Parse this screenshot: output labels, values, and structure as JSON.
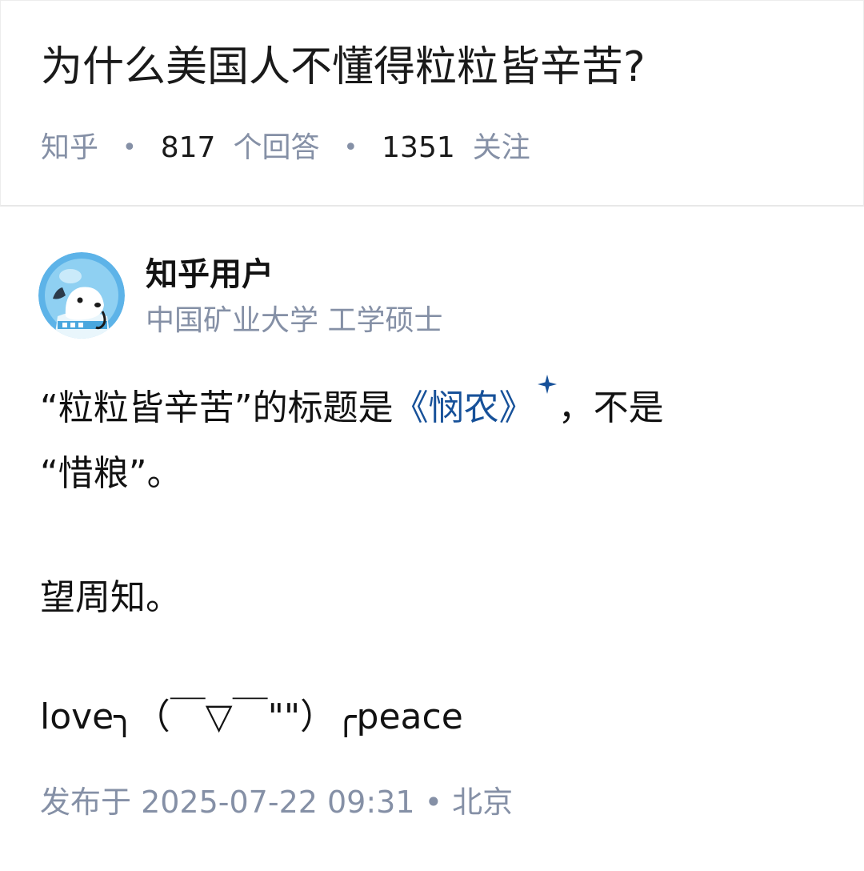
{
  "question": {
    "title": "为什么美国人不懂得粒粒皆辛苦?",
    "source": "知乎",
    "answer_count": "817",
    "answer_count_label": "个回答",
    "follow_count": "1351",
    "follow_label": "关注",
    "separator": "•"
  },
  "answer": {
    "author": {
      "name": "知乎用户",
      "headline": "中国矿业大学  工学硕士",
      "avatar_icon": "astronaut-dog-avatar"
    },
    "paragraph1": {
      "before": "“粒粒皆辛苦”的标题是",
      "link": "《悯农》",
      "after": "，不是"
    },
    "paragraph2": "“惜粮”。",
    "paragraph3": "望周知。",
    "paragraph4": "love╮（￣▽￣\"\"）╭peace",
    "publish_time": "发布于  2025-07-22  09:31 • 北京"
  },
  "colors": {
    "link": "#175199",
    "muted": "#8590a6",
    "text": "#121212"
  }
}
